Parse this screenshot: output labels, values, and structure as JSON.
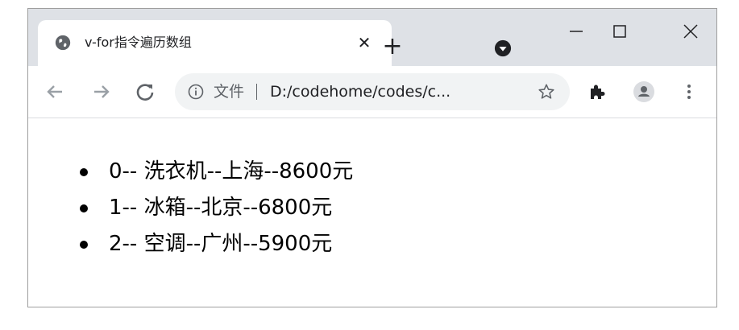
{
  "tab": {
    "title": "v-for指令遍历数组",
    "close_glyph": "✕"
  },
  "titlebar": {
    "new_tab_glyph": "+"
  },
  "omnibox": {
    "security_label": "文件",
    "url": "D:/codehome/codes/c..."
  },
  "list_items": [
    {
      "text": "0-- 洗衣机--上海--8600元"
    },
    {
      "text": "1-- 冰箱--北京--6800元"
    },
    {
      "text": "2-- 空调--广州--5900元"
    }
  ],
  "colors": {
    "titlebar_bg": "#dee1e6",
    "omnibox_bg": "#f1f3f4",
    "icon": "#5f6368",
    "text": "#202124"
  },
  "icons": {
    "favicon": "globe-icon",
    "tab_search": "chevron-down-circle-icon",
    "minimize": "minimize-icon",
    "maximize": "maximize-icon",
    "close": "close-icon",
    "back": "arrow-left-icon",
    "forward": "arrow-right-icon",
    "reload": "reload-icon",
    "info": "info-icon",
    "bookmark": "star-icon",
    "extensions": "puzzle-icon",
    "profile": "account-icon",
    "menu": "kebab-menu-icon"
  }
}
